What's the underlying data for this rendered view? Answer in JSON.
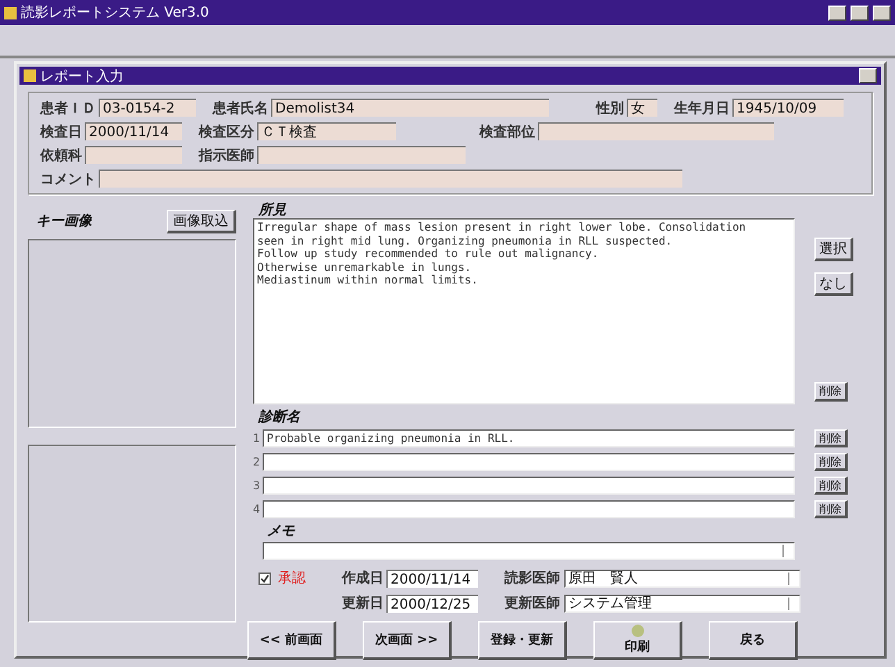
{
  "app_window": {
    "title": "読影レポートシステム Ver3.0"
  },
  "report_window": {
    "title": "レポート入力"
  },
  "header_rows": [
    [
      {
        "label": "患者ＩＤ",
        "value": "03-0154-2"
      },
      {
        "label": "患者氏名",
        "value": "Demolist34"
      },
      {
        "label": "性別",
        "value": "女"
      },
      {
        "label": "生年月日",
        "value": "1945/10/09"
      }
    ],
    [
      {
        "label": "検査日",
        "value": "2000/11/14"
      },
      {
        "label": "検査区分",
        "value": "ＣＴ検査"
      },
      {
        "label": "検査部位"
      }
    ],
    [
      {
        "label": "依頼科"
      },
      {
        "label": "指示医師"
      }
    ],
    [
      {
        "label": "コメント"
      }
    ]
  ],
  "key_images": {
    "label": "キー画像",
    "button": "画像取込"
  },
  "findings": {
    "label": "所見",
    "lines": [
      "Irregular shape of mass lesion present in right lower lobe. Consolidation",
      "seen in right mid lung. Organizing pneumonia in RLL suspected.",
      "Follow up study recommended to rule out malignancy.",
      "Otherwise unremarkable in lungs.",
      "Mediastinum within normal limits."
    ],
    "buttons": [
      "選択",
      "なし"
    ],
    "delete_button": "削除"
  },
  "diagnoses": {
    "label": "診断名",
    "rows": [
      {
        "number": "1",
        "value": "Probable organizing pneumonia in RLL.",
        "button": "削除"
      },
      {
        "number": "2",
        "button": "削除"
      },
      {
        "number": "3",
        "button": "削除"
      },
      {
        "number": "4",
        "button": "削除"
      }
    ]
  },
  "memo": {
    "label": "メモ"
  },
  "approval": {
    "label": "承認",
    "checked": true
  },
  "dates": [
    {
      "label": "作成日",
      "value": "2000/11/14",
      "doctor_label": "読影医師",
      "doctor": "原田　賢人"
    },
    {
      "label": "更新日",
      "value": "2000/12/25",
      "doctor_label": "更新医師",
      "doctor": "システム管理"
    }
  ],
  "buttons": [
    {
      "kind": "text",
      "label": "<< 前画面"
    },
    {
      "kind": "text",
      "label": "次画面 >>"
    },
    {
      "kind": "text",
      "label": "登録・更新"
    },
    {
      "kind": "icon",
      "label": "印刷"
    },
    {
      "kind": "text",
      "label": "戻る"
    }
  ]
}
